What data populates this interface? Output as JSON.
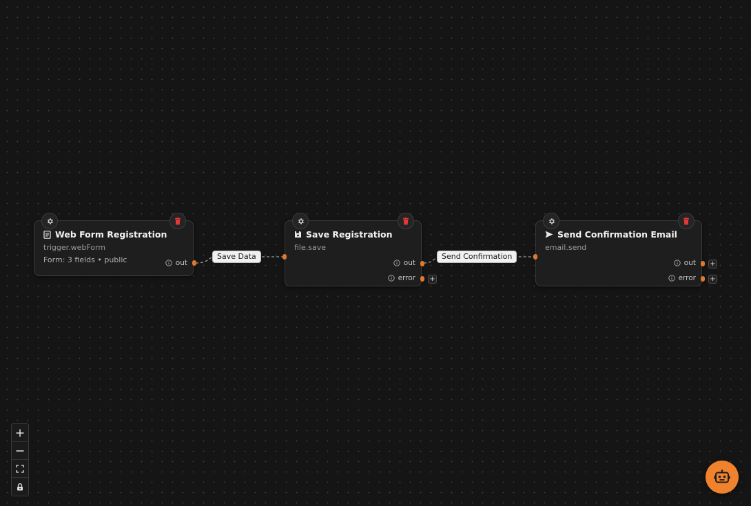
{
  "nodes": [
    {
      "id": "web-form-registration",
      "title": "Web Form Registration",
      "type": "trigger.webForm",
      "description": "Form: 3 fields • public",
      "icon": "form-icon",
      "outputs": [
        "out"
      ]
    },
    {
      "id": "save-registration",
      "title": "Save Registration",
      "type": "file.save",
      "icon": "save-icon",
      "outputs": [
        "out",
        "error"
      ]
    },
    {
      "id": "send-confirmation-email",
      "title": "Send Confirmation Email",
      "type": "email.send",
      "icon": "send-icon",
      "outputs": [
        "out",
        "error"
      ]
    }
  ],
  "edges": [
    {
      "from": "web-form-registration",
      "to": "save-registration",
      "label": "Save Data"
    },
    {
      "from": "save-registration",
      "to": "send-confirmation-email",
      "label": "Send Confirmation"
    }
  ],
  "add_label": "+",
  "controls": [
    "zoom-in-icon",
    "zoom-out-icon",
    "fit-view-icon",
    "lock-icon"
  ],
  "colors": {
    "accent": "#f0812d",
    "handle": "#e0782f",
    "delete": "#e53935",
    "canvas": "#151515",
    "node": "#1e1e1e"
  }
}
